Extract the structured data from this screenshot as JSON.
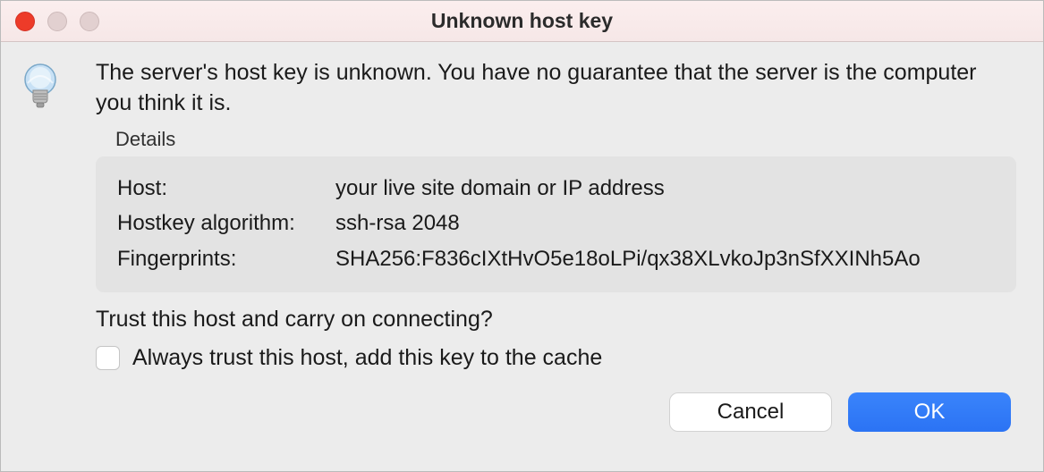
{
  "window": {
    "title": "Unknown host key"
  },
  "message": "The server's host key is unknown. You have no guarantee that the server is the computer you think it is.",
  "details": {
    "heading": "Details",
    "host_label": "Host:",
    "host_value": "your live site domain or IP address",
    "algorithm_label": "Hostkey algorithm:",
    "algorithm_value": "ssh-rsa 2048",
    "fingerprints_label": "Fingerprints:",
    "fingerprints_value": "SHA256:F836cIXtHvO5e18oLPi/qx38XLvkoJp3nSfXXINh5Ao"
  },
  "trust_question": "Trust this host and carry on connecting?",
  "checkbox": {
    "label": "Always trust this host, add this key to the cache"
  },
  "buttons": {
    "cancel": "Cancel",
    "ok": "OK"
  }
}
